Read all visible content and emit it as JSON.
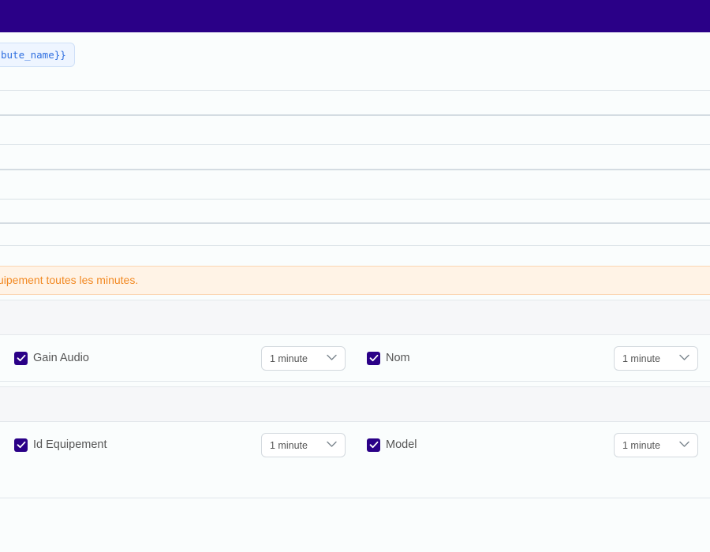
{
  "header": {
    "color": "#2a0087"
  },
  "template_chip": {
    "text": "bute_name}}"
  },
  "alert": {
    "text": "uipement toutes les minutes."
  },
  "rows": [
    {
      "left": {
        "label": "Gain Audio",
        "checked": true,
        "interval": "1 minute"
      },
      "right": {
        "label": "Nom",
        "checked": true,
        "interval": "1 minute"
      }
    },
    {
      "left": {
        "label": "Id Equipement",
        "checked": true,
        "interval": "1 minute"
      },
      "right": {
        "label": "Model",
        "checked": true,
        "interval": "1 minute"
      }
    }
  ],
  "icons": {
    "checkbox": "check-icon",
    "select": "chevron-down-icon"
  },
  "colors": {
    "accent": "#2a0087",
    "alert_text": "#f28a24",
    "alert_bg": "#fff3e6",
    "link": "#2f6fe0"
  }
}
